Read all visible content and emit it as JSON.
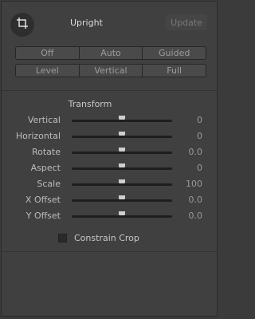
{
  "header": {
    "crop_icon": "crop-icon",
    "title": "Upright",
    "update_label": "Update"
  },
  "upright_modes": {
    "row1": [
      "Off",
      "Auto",
      "Guided"
    ],
    "row2": [
      "Level",
      "Vertical",
      "Full"
    ]
  },
  "transform": {
    "title": "Transform",
    "sliders": [
      {
        "label": "Vertical",
        "value": "0"
      },
      {
        "label": "Horizontal",
        "value": "0"
      },
      {
        "label": "Rotate",
        "value": "0.0"
      },
      {
        "label": "Aspect",
        "value": "0"
      },
      {
        "label": "Scale",
        "value": "100"
      },
      {
        "label": "X Offset",
        "value": "0.0"
      },
      {
        "label": "Y Offset",
        "value": "0.0"
      }
    ],
    "constrain_crop_label": "Constrain Crop",
    "constrain_crop_checked": false
  }
}
